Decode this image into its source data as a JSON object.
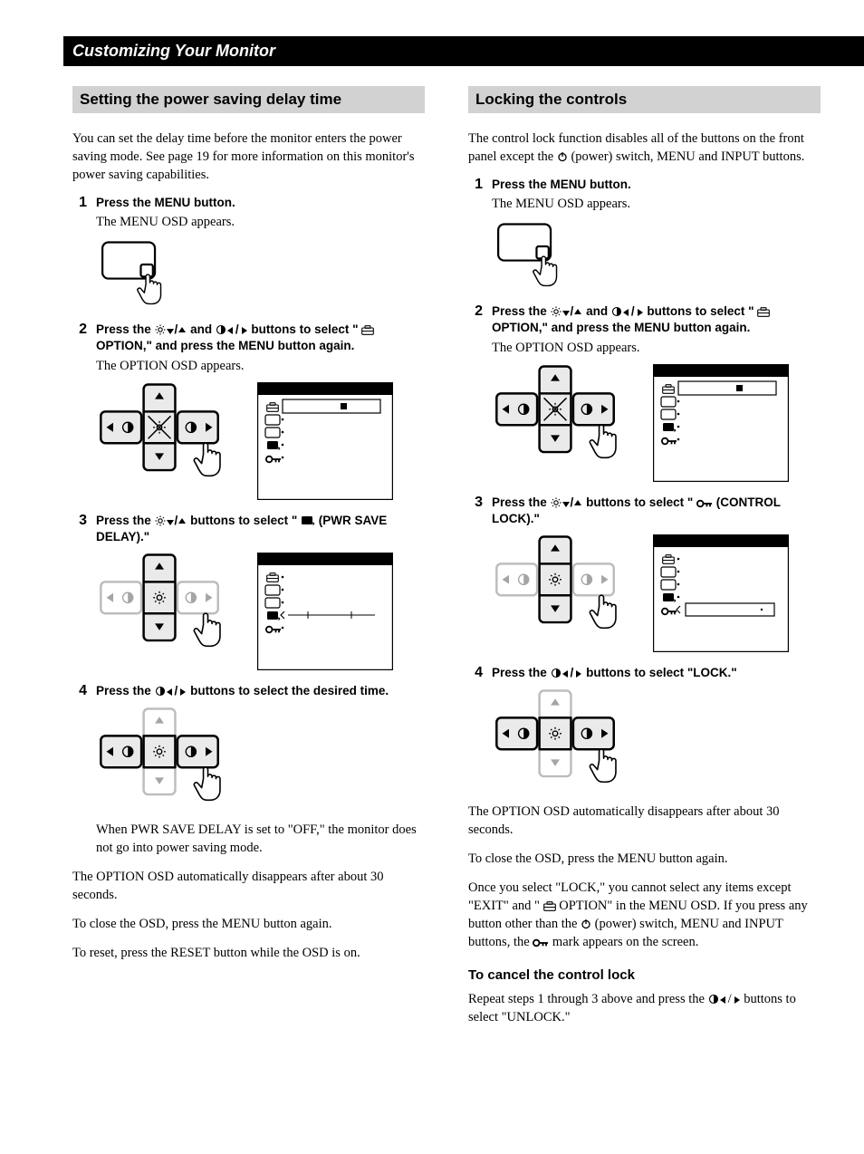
{
  "banner": "Customizing Your Monitor",
  "left": {
    "header": "Setting the power saving delay time",
    "intro": "You can set the delay time before the monitor enters the power saving mode. See page 19 for more information on this monitor's power saving capabilities.",
    "step1_title": "Press the MENU button.",
    "step1_desc": "The MENU OSD appears.",
    "step2_pre": "Press the ",
    "step2_mid1": " and ",
    "step2_mid2": " buttons to select \" ",
    "step2_end": " OPTION,\" and press the MENU button again.",
    "step2_desc": "The OPTION OSD appears.",
    "step3_pre": "Press the ",
    "step3_mid": " buttons to select \" ",
    "step3_end": "  (PWR SAVE DELAY).\"",
    "step4_pre": "Press the ",
    "step4_end": " buttons to select the desired time.",
    "note1": "When PWR SAVE DELAY is set to \"OFF,\" the monitor does not go into power saving mode.",
    "note2": "The OPTION OSD automatically disappears after about 30 seconds.",
    "note3": "To close the OSD, press the MENU button again.",
    "note4": "To reset,  press the RESET button while the OSD is on."
  },
  "right": {
    "header": "Locking the controls",
    "intro_pre": "The control lock function disables all of the buttons on the front panel except the ",
    "intro_end": " (power) switch, MENU and INPUT buttons.",
    "step1_title": "Press the MENU button.",
    "step1_desc": "The MENU OSD appears.",
    "step2_pre": "Press the ",
    "step2_mid1": " and ",
    "step2_mid2": " buttons to select \" ",
    "step2_end": " OPTION,\" and press the MENU button again.",
    "step2_desc": "The OPTION OSD appears.",
    "step3_pre": "Press the ",
    "step3_mid": " buttons to select \"",
    "step3_end": "  (CONTROL LOCK).\"",
    "step4_pre": "Press the ",
    "step4_end": " buttons to select \"LOCK.\"",
    "note1": "The OPTION OSD automatically disappears after about 30 seconds.",
    "note2": "To close the OSD, press the MENU button again.",
    "note3_pre": "Once you select \"LOCK,\" you cannot select any items except \"EXIT\" and \" ",
    "note3_mid": " OPTION\" in the MENU OSD. If you press any button other than the ",
    "note3_mid2": " (power) switch, MENU and INPUT buttons, the ",
    "note3_end": " mark appears on the screen.",
    "subhead": "To cancel the control lock",
    "cancel_pre": "Repeat steps 1 through 3 above and press the ",
    "cancel_end": " buttons to select \"UNLOCK.\""
  }
}
